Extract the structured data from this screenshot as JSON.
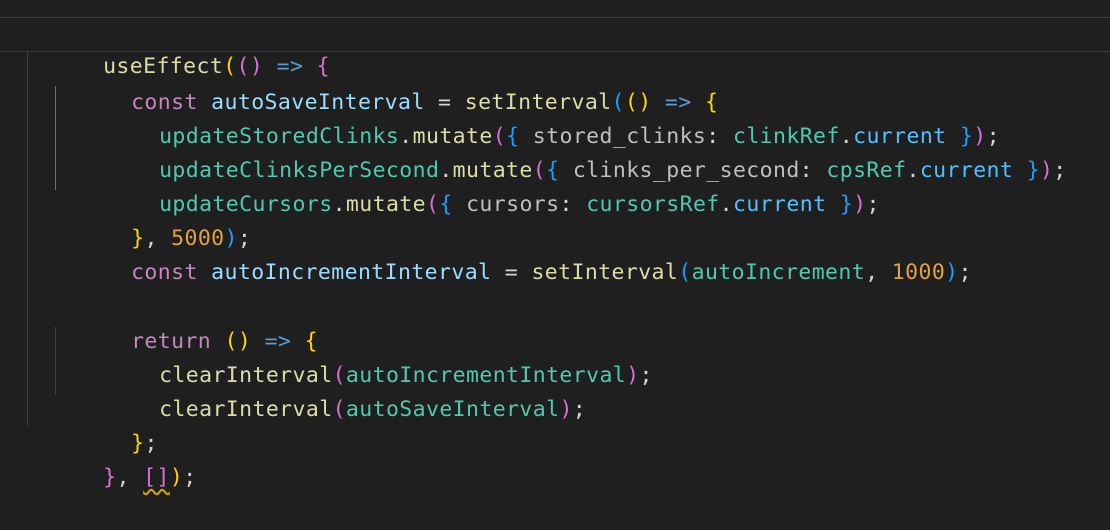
{
  "code": {
    "l1": [
      "useEffect",
      "(",
      "()",
      " => ",
      "{"
    ],
    "l2": [
      "const",
      " autoSaveInterval ",
      "=",
      " setInterval",
      "(",
      "()",
      " => ",
      "{"
    ],
    "l3": [
      "updateStoredClinks",
      ".",
      "mutate",
      "(",
      "{",
      " stored_clinks",
      ":",
      " clinkRef",
      ".",
      "current",
      " }",
      ")",
      ";"
    ],
    "l4": [
      "updateClinksPerSecond",
      ".",
      "mutate",
      "(",
      "{",
      " clinks_per_second",
      ":",
      " cpsRef",
      ".",
      "current",
      " }",
      ")",
      ";"
    ],
    "l5": [
      "updateCursors",
      ".",
      "mutate",
      "(",
      "{",
      " cursors",
      ":",
      " cursorsRef",
      ".",
      "current",
      " }",
      ")",
      ";"
    ],
    "l6": [
      "}",
      ", ",
      "5000",
      ")",
      ";"
    ],
    "l7": [
      "const",
      " autoIncrementInterval ",
      "=",
      " setInterval",
      "(",
      "autoIncrement",
      ", ",
      "1000",
      ")",
      ";"
    ],
    "l9": [
      "return",
      " ",
      "()",
      " => ",
      "{"
    ],
    "l10": [
      "clearInterval",
      "(",
      "autoIncrementInterval",
      ")",
      ";"
    ],
    "l11": [
      "clearInterval",
      "(",
      "autoSaveInterval",
      ")",
      ";"
    ],
    "l12": [
      "}",
      ";"
    ],
    "l13": [
      "}",
      ", ",
      "[]",
      ")",
      ";"
    ]
  }
}
